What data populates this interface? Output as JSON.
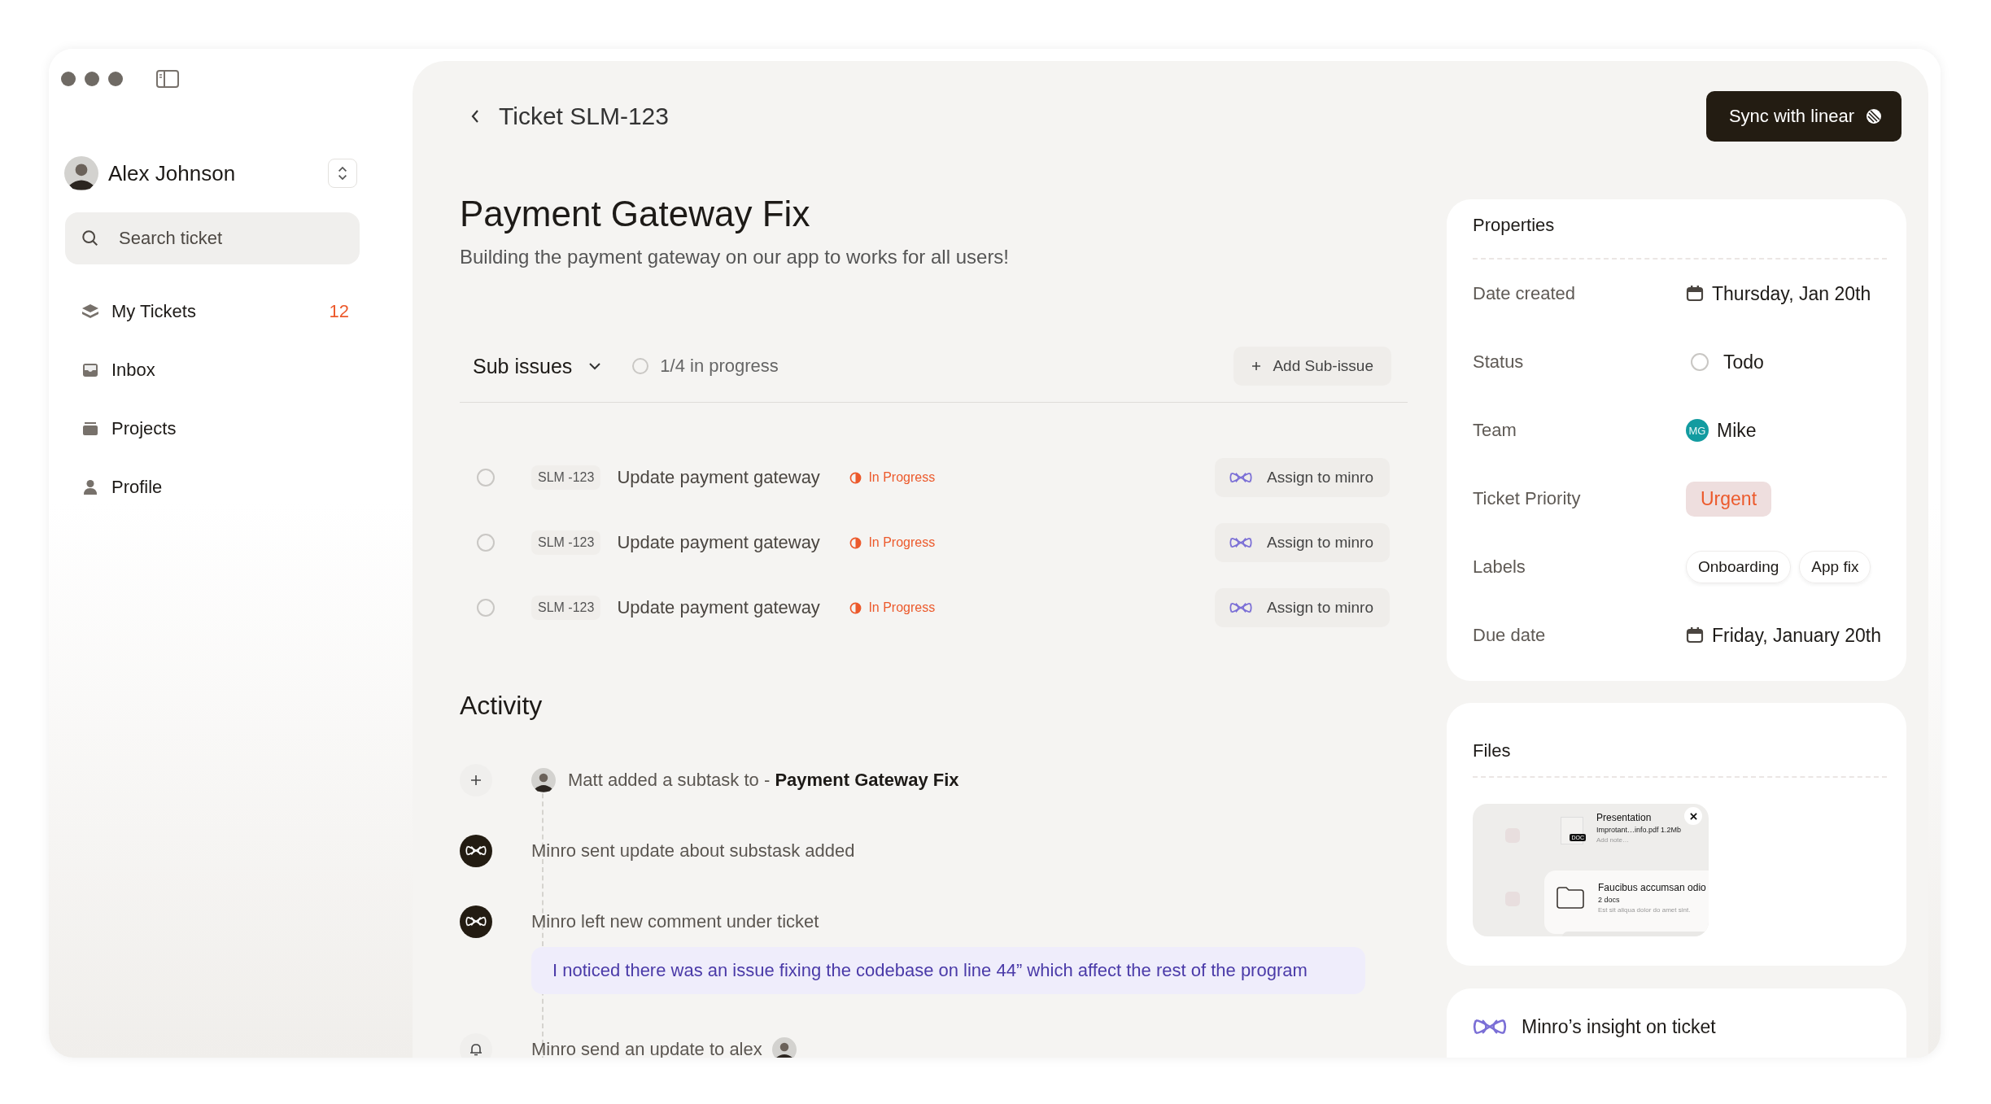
{
  "sidebar": {
    "user": {
      "name": "Alex Johnson"
    },
    "search": {
      "placeholder": "Search ticket"
    },
    "items": [
      {
        "label": "My Tickets",
        "count": "12"
      },
      {
        "label": "Inbox"
      },
      {
        "label": "Projects"
      },
      {
        "label": "Profile"
      }
    ]
  },
  "header": {
    "breadcrumb": "Ticket SLM-123",
    "sync_button": "Sync with linear"
  },
  "ticket": {
    "title": "Payment Gateway Fix",
    "description": "Building the payment gateway on our app to works for all users!"
  },
  "sub_issues": {
    "title": "Sub issues",
    "progress": "1/4 in progress",
    "add_button": "Add Sub-issue",
    "rows": [
      {
        "checked": false,
        "id": "SLM -123",
        "title": "Update payment gateway",
        "status": "In Progress",
        "assign": "Assign to minro"
      },
      {
        "checked": false,
        "id": "SLM -123",
        "title": "Update payment gateway",
        "status": "In Progress",
        "assign": "Assign to minro"
      },
      {
        "checked": false,
        "id": "SLM -123",
        "title": "Update payment gateway",
        "status": "In Progress",
        "assign": "Assign to minro"
      }
    ]
  },
  "activity": {
    "title": "Activity",
    "items": [
      {
        "kind": "subtask",
        "text": "Matt added a subtask to  - **Payment Gateway Fix**"
      },
      {
        "kind": "bot",
        "text": "Minro sent update about substask added"
      },
      {
        "kind": "bot",
        "text": "Minro left new comment under ticket",
        "comment": "I noticed there was an issue fixing the codebase on line 44” which affect the rest of the program"
      },
      {
        "kind": "notification",
        "text": "Minro send an update to alex"
      }
    ]
  },
  "properties": {
    "title": "Properties",
    "rows": [
      {
        "kind": "date",
        "label": "Date created",
        "value": "Thursday, Jan 20th"
      },
      {
        "kind": "status",
        "label": "Status",
        "value": "Todo"
      },
      {
        "kind": "person",
        "label": "Team",
        "initials": "MG",
        "value": "Mike"
      },
      {
        "kind": "priority",
        "label": "Ticket Priority",
        "value": "Urgent"
      },
      {
        "kind": "tags",
        "label": "Labels",
        "tags": [
          "Onboarding",
          "App fix"
        ]
      },
      {
        "kind": "date",
        "label": "Due date",
        "value": "Friday, January 20th"
      }
    ]
  },
  "files": {
    "title": "Files",
    "items": [
      {
        "kind": "doc",
        "name": "Presentation",
        "detail": "Improtant…info.pdf 1.2Mb",
        "note": "Add note…",
        "badge": "DOC"
      },
      {
        "kind": "folder",
        "name": "Faucibus accumsan odio",
        "detail": "2 docs",
        "note": "Est sit aliqua dolor do amet sint."
      }
    ]
  },
  "insight": {
    "title": "Minro’s insight on ticket"
  }
}
